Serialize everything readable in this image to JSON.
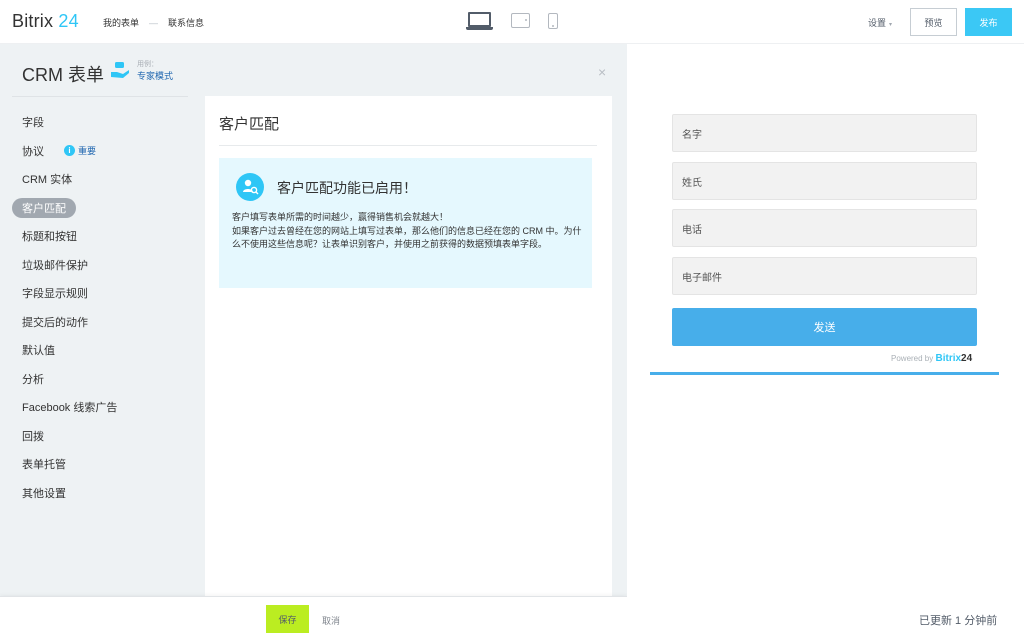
{
  "brand": {
    "name": "Bitrix",
    "num": "24"
  },
  "breadcrumbs": {
    "first": "我的表单",
    "sep": "—",
    "second": "联系信息"
  },
  "devices": [
    "laptop-icon",
    "tablet-icon",
    "phone-icon"
  ],
  "toolbar": {
    "settings_label": "设置",
    "settings_caret": "▾",
    "preview_label": "预览",
    "publish_label": "发布"
  },
  "editor": {
    "title": "CRM 表单",
    "mode_prefix": "用例：",
    "mode_link": "专家模式",
    "close_glyph": "×"
  },
  "nav": {
    "items": [
      {
        "label": "字段"
      },
      {
        "label": "协议",
        "badge": "i",
        "badge_text": "重要"
      },
      {
        "label": "CRM 实体"
      },
      {
        "label": "客户匹配",
        "active": true
      },
      {
        "label": "标题和按钮"
      },
      {
        "label": "垃圾邮件保护"
      },
      {
        "label": "字段显示规则"
      },
      {
        "label": "提交后的动作"
      },
      {
        "label": "默认值"
      },
      {
        "label": "分析"
      },
      {
        "label": "Facebook 线索广告"
      },
      {
        "label": "回拨"
      },
      {
        "label": "表单托管"
      },
      {
        "label": "其他设置"
      }
    ]
  },
  "panel": {
    "title": "客户匹配",
    "notice_head": "客户匹配功能已启用！",
    "notice_line1": "客户填写表单所需的时间越少，赢得销售机会就越大！",
    "notice_line2": "如果客户过去曾经在您的网站上填写过表单，那么他们的信息已经在您的 CRM 中。为什么不使用这些信息呢？让表单识别客户，并使用之前获得的数据预填表单字段。"
  },
  "footer": {
    "save_label": "保存",
    "cancel_label": "取消"
  },
  "preview": {
    "fields": [
      "名字",
      "姓氏",
      "电话",
      "电子邮件"
    ],
    "send_label": "发送",
    "powered_prefix": "Powered by",
    "powered_brand": "Bitrix",
    "powered_num": "24",
    "updated": "已更新 1 分钟前"
  },
  "colors": {
    "accent": "#2fc6f6",
    "send": "#47aeea",
    "save": "#bbed21",
    "active_nav": "#a1a8b0"
  }
}
